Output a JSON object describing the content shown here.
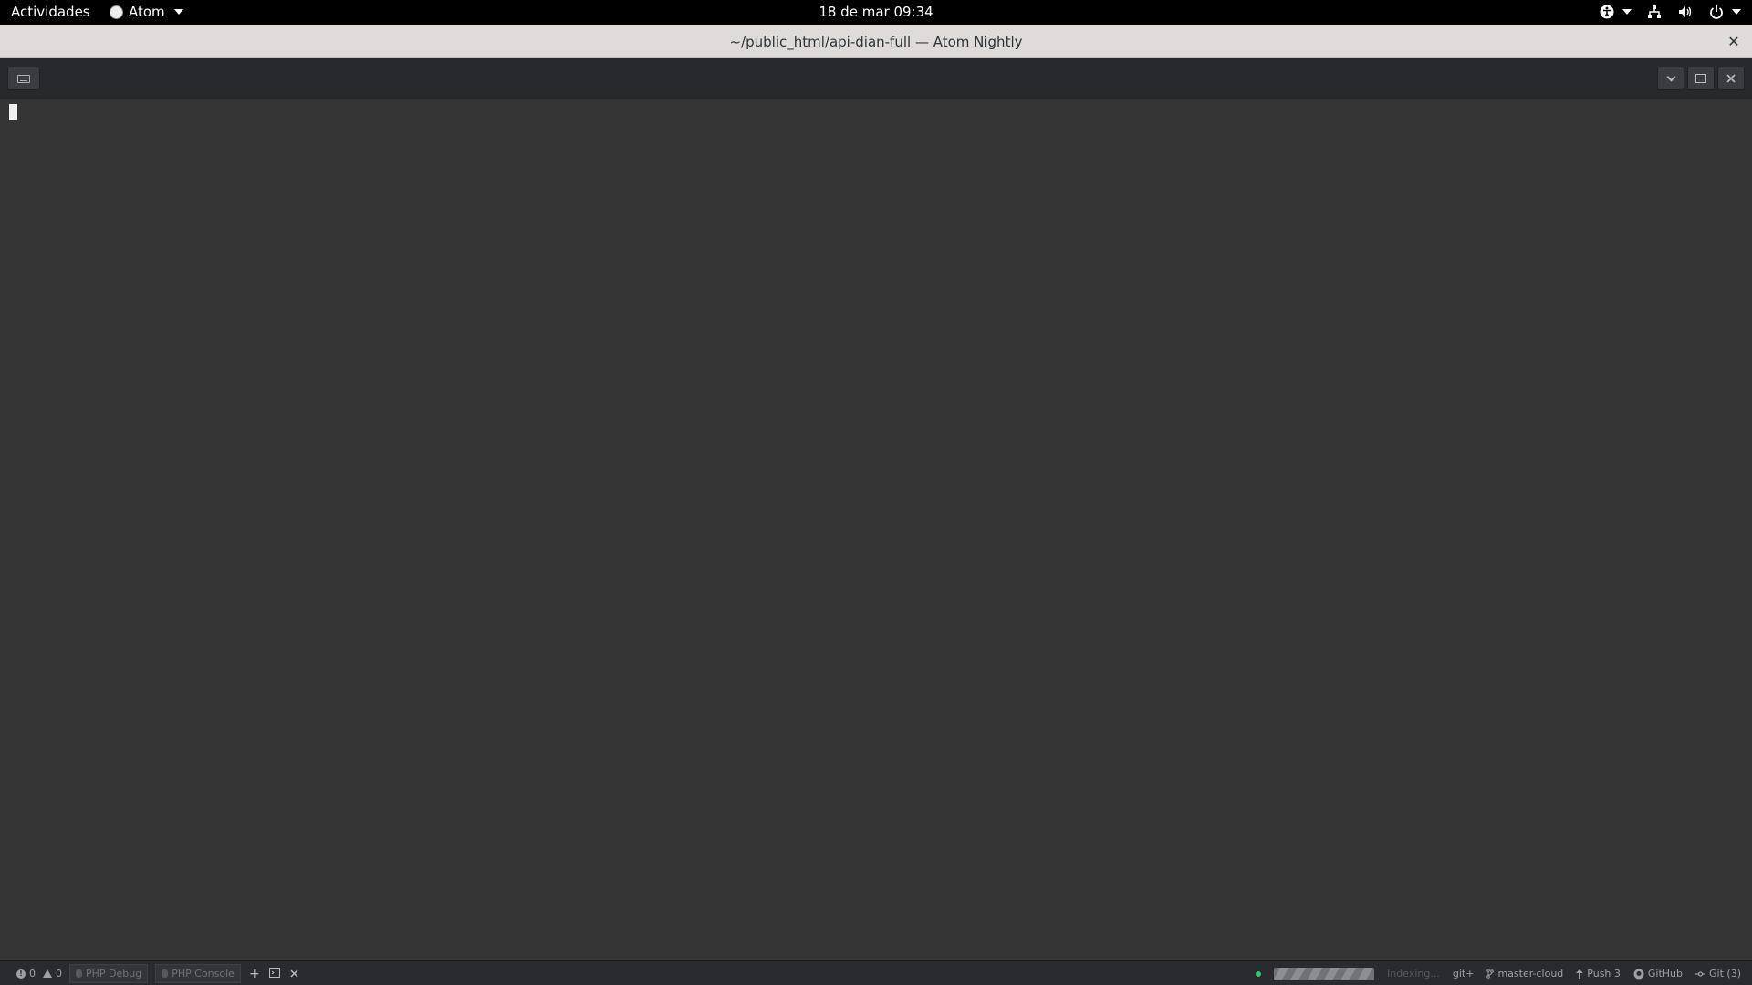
{
  "topbar": {
    "activities": "Actividades",
    "app_name": "Atom",
    "clock": "18 de mar  09:34"
  },
  "window": {
    "title": "~/public_html/api-dian-full — Atom Nightly",
    "close_glyph": "✕"
  },
  "statusbar": {
    "errors": "0",
    "warnings": "0",
    "php_debug": "PHP Debug",
    "php_console": "PHP Console",
    "indexing": "Indexing...",
    "git_plus": "git+",
    "branch": "master-cloud",
    "push": "Push 3",
    "github": "GitHub",
    "git": "Git (3)"
  },
  "colors": {
    "terminal_bg": "#353535",
    "status_ok": "#2ecc71"
  }
}
